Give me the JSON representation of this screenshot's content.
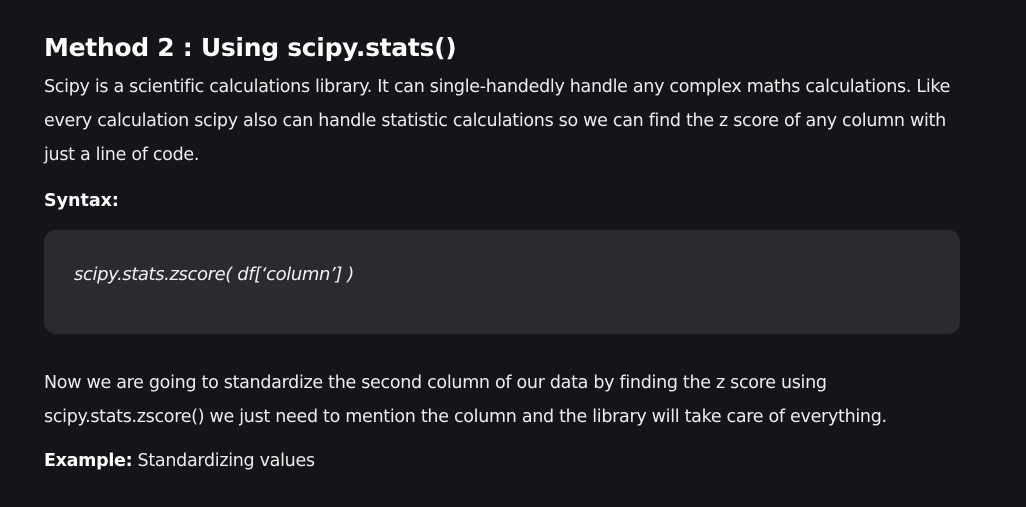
{
  "article": {
    "heading": "Method 2 : Using scipy.stats()",
    "intro_paragraph": "Scipy is a scientific calculations library. It can single-handedly handle any complex maths calculations. Like every calculation scipy also can handle statistic calculations so we can find the z score of any column with just a line of code.",
    "syntax_label": "Syntax:",
    "code": "scipy.stats.zscore( df[‘column’] )",
    "second_paragraph": "Now we are going to standardize the second column of our data by finding the z score using scipy.stats.zscore() we just need to mention the column and the library will take care of everything.",
    "example_label": "Example:",
    "example_text": " Standardizing values"
  },
  "colors": {
    "background": "#141519",
    "code_background": "#2a2b2f",
    "text": "#eeeeee"
  }
}
